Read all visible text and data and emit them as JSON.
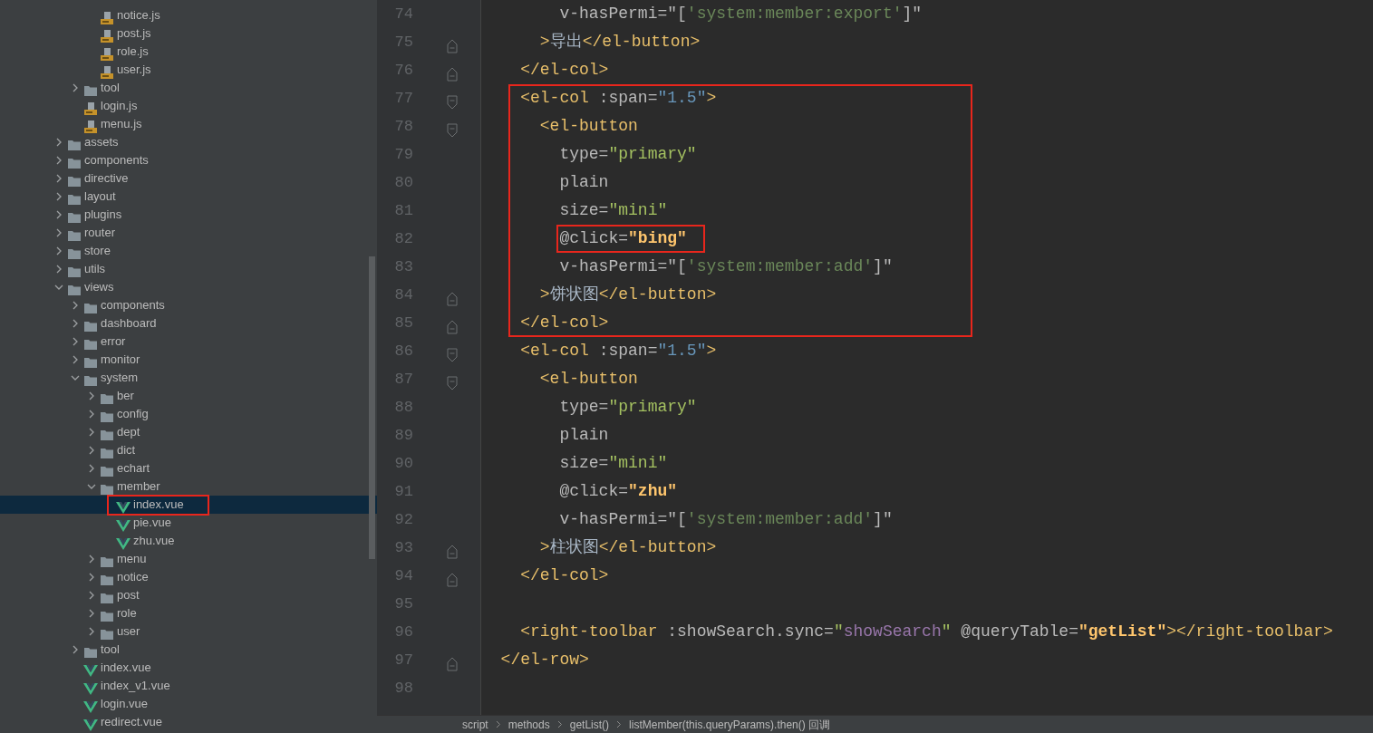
{
  "project_tree": [
    {
      "children": [
        {
          "children": [
            {
              "label": "notice.js",
              "kind": "js",
              "selected": false
            },
            {
              "label": "post.js",
              "kind": "js",
              "selected": false
            },
            {
              "label": "role.js",
              "kind": "js",
              "selected": false
            },
            {
              "label": "user.js",
              "kind": "js",
              "selected": false
            }
          ]
        },
        {
          "label": "tool",
          "kind": "folder",
          "expanded": false,
          "selected": false
        },
        {
          "label": "login.js",
          "kind": "js",
          "selected": false
        },
        {
          "label": "menu.js",
          "kind": "js",
          "selected": false
        }
      ]
    },
    {
      "label": "assets",
      "kind": "folder",
      "expanded": false,
      "selected": false
    },
    {
      "label": "components",
      "kind": "folder",
      "expanded": false,
      "selected": false
    },
    {
      "label": "directive",
      "kind": "folder",
      "expanded": false,
      "selected": false
    },
    {
      "label": "layout",
      "kind": "folder",
      "expanded": false,
      "selected": false
    },
    {
      "label": "plugins",
      "kind": "folder",
      "expanded": false,
      "selected": false
    },
    {
      "label": "router",
      "kind": "folder",
      "expanded": false,
      "selected": false
    },
    {
      "label": "store",
      "kind": "folder",
      "expanded": false,
      "selected": false
    },
    {
      "label": "utils",
      "kind": "folder",
      "expanded": false,
      "selected": false
    },
    {
      "label": "views",
      "kind": "folder",
      "expanded": true,
      "selected": false,
      "children": [
        {
          "label": "components",
          "kind": "folder",
          "expanded": false,
          "selected": false
        },
        {
          "label": "dashboard",
          "kind": "folder",
          "expanded": false,
          "selected": false
        },
        {
          "label": "error",
          "kind": "folder",
          "expanded": false,
          "selected": false
        },
        {
          "label": "monitor",
          "kind": "folder",
          "expanded": false,
          "selected": false
        },
        {
          "label": "system",
          "kind": "folder",
          "expanded": true,
          "selected": false,
          "children": [
            {
              "label": "ber",
              "kind": "folder",
              "expanded": false,
              "selected": false
            },
            {
              "label": "config",
              "kind": "folder",
              "expanded": false,
              "selected": false
            },
            {
              "label": "dept",
              "kind": "folder",
              "expanded": false,
              "selected": false
            },
            {
              "label": "dict",
              "kind": "folder",
              "expanded": false,
              "selected": false
            },
            {
              "label": "echart",
              "kind": "folder",
              "expanded": false,
              "selected": false
            },
            {
              "label": "member",
              "kind": "folder",
              "expanded": true,
              "selected": false,
              "children": [
                {
                  "label": "index.vue",
                  "kind": "vue",
                  "selected": true,
                  "boxed": true
                },
                {
                  "label": "pie.vue",
                  "kind": "vue",
                  "selected": false
                },
                {
                  "label": "zhu.vue",
                  "kind": "vue",
                  "selected": false
                }
              ]
            },
            {
              "label": "menu",
              "kind": "folder",
              "expanded": false,
              "selected": false
            },
            {
              "label": "notice",
              "kind": "folder",
              "expanded": false,
              "selected": false
            },
            {
              "label": "post",
              "kind": "folder",
              "expanded": false,
              "selected": false
            },
            {
              "label": "role",
              "kind": "folder",
              "expanded": false,
              "selected": false
            },
            {
              "label": "user",
              "kind": "folder",
              "expanded": false,
              "selected": false
            }
          ]
        },
        {
          "label": "tool",
          "kind": "folder",
          "expanded": false,
          "selected": false
        },
        {
          "label": "index.vue",
          "kind": "vue",
          "selected": false
        },
        {
          "label": "index_v1.vue",
          "kind": "vue",
          "selected": false
        },
        {
          "label": "login.vue",
          "kind": "vue",
          "selected": false
        },
        {
          "label": "redirect.vue",
          "kind": "vue",
          "selected": false
        }
      ]
    }
  ],
  "editor": {
    "lines": [
      {
        "number": "74",
        "tokens": [
          {
            "text": "        v-hasPermi=\"[",
            "kind": "a"
          },
          {
            "text": "'system:member:export'",
            "kind": "g"
          },
          {
            "text": "]\"",
            "kind": "a"
          }
        ]
      },
      {
        "number": "75",
        "fold_end": true,
        "tokens": [
          {
            "text": "      >",
            "kind": "t"
          },
          {
            "text": "导出",
            "kind": "p"
          },
          {
            "text": "</el-button>",
            "kind": "t"
          }
        ]
      },
      {
        "number": "76",
        "fold_end": true,
        "tokens": [
          {
            "text": "    </el-col>",
            "kind": "t"
          }
        ]
      },
      {
        "number": "77",
        "fold_start": true,
        "boxed": true,
        "tokens": [
          {
            "text": "    <el-col",
            "kind": "t"
          },
          {
            "text": " :span=",
            "kind": "a"
          },
          {
            "text": "\"1.5\"",
            "kind": "n"
          },
          {
            "text": ">",
            "kind": "t"
          }
        ]
      },
      {
        "number": "78",
        "fold_start": true,
        "boxed": true,
        "tokens": [
          {
            "text": "      <el-button",
            "kind": "t"
          }
        ]
      },
      {
        "number": "79",
        "boxed": true,
        "tokens": [
          {
            "text": "        type=",
            "kind": "a"
          },
          {
            "text": "\"primary\"",
            "kind": "s"
          }
        ]
      },
      {
        "number": "80",
        "boxed": true,
        "tokens": [
          {
            "text": "        plain",
            "kind": "a"
          }
        ]
      },
      {
        "number": "81",
        "boxed": true,
        "tokens": [
          {
            "text": "        size=",
            "kind": "a"
          },
          {
            "text": "\"mini\"",
            "kind": "s"
          }
        ]
      },
      {
        "number": "82",
        "boxed": true,
        "token_box": true,
        "tokens": [
          {
            "text": "        @click=",
            "kind": "a"
          },
          {
            "text": "\"bing\"",
            "kind": "f"
          }
        ]
      },
      {
        "number": "83",
        "boxed": true,
        "tokens": [
          {
            "text": "        v-hasPermi=\"[",
            "kind": "a"
          },
          {
            "text": "'system:member:add'",
            "kind": "g"
          },
          {
            "text": "]\"",
            "kind": "a"
          }
        ]
      },
      {
        "number": "84",
        "fold_end": true,
        "boxed": true,
        "tokens": [
          {
            "text": "      >",
            "kind": "t"
          },
          {
            "text": "饼状图",
            "kind": "p"
          },
          {
            "text": "</el-button>",
            "kind": "t"
          }
        ]
      },
      {
        "number": "85",
        "fold_end": true,
        "boxed": true,
        "tokens": [
          {
            "text": "    </el-col>",
            "kind": "t"
          }
        ]
      },
      {
        "number": "86",
        "fold_start": true,
        "tokens": [
          {
            "text": "    <el-col",
            "kind": "t"
          },
          {
            "text": " :span=",
            "kind": "a"
          },
          {
            "text": "\"1.5\"",
            "kind": "n"
          },
          {
            "text": ">",
            "kind": "t"
          }
        ]
      },
      {
        "number": "87",
        "fold_start": true,
        "tokens": [
          {
            "text": "      <el-button",
            "kind": "t"
          }
        ]
      },
      {
        "number": "88",
        "tokens": [
          {
            "text": "        type=",
            "kind": "a"
          },
          {
            "text": "\"primary\"",
            "kind": "s"
          }
        ]
      },
      {
        "number": "89",
        "tokens": [
          {
            "text": "        plain",
            "kind": "a"
          }
        ]
      },
      {
        "number": "90",
        "tokens": [
          {
            "text": "        size=",
            "kind": "a"
          },
          {
            "text": "\"mini\"",
            "kind": "s"
          }
        ]
      },
      {
        "number": "91",
        "tokens": [
          {
            "text": "        @click=",
            "kind": "a"
          },
          {
            "text": "\"zhu\"",
            "kind": "f"
          }
        ]
      },
      {
        "number": "92",
        "tokens": [
          {
            "text": "        v-hasPermi=\"[",
            "kind": "a"
          },
          {
            "text": "'system:member:add'",
            "kind": "g"
          },
          {
            "text": "]\"",
            "kind": "a"
          }
        ]
      },
      {
        "number": "93",
        "fold_end": true,
        "tokens": [
          {
            "text": "      >",
            "kind": "t"
          },
          {
            "text": "柱状图",
            "kind": "p"
          },
          {
            "text": "</el-button>",
            "kind": "t"
          }
        ]
      },
      {
        "number": "94",
        "fold_end": true,
        "tokens": [
          {
            "text": "    </el-col>",
            "kind": "t"
          }
        ]
      },
      {
        "number": "95"
      },
      {
        "number": "96",
        "tokens": [
          {
            "text": "    <right-toolbar",
            "kind": "t"
          },
          {
            "text": " :showSearch.sync=",
            "kind": "a"
          },
          {
            "text": "\"",
            "kind": "s"
          },
          {
            "text": "showSearch",
            "kind": "v"
          },
          {
            "text": "\"",
            "kind": "s"
          },
          {
            "text": " @queryTable=",
            "kind": "a"
          },
          {
            "text": "\"getList\"",
            "kind": "f"
          },
          {
            "text": "></right-toolbar>",
            "kind": "t"
          }
        ]
      },
      {
        "number": "97",
        "fold_end": true,
        "tokens": [
          {
            "text": "  </el-row>",
            "kind": "t"
          }
        ]
      },
      {
        "number": "98"
      }
    ]
  },
  "breadcrumb": [
    "script",
    "methods",
    "getList()",
    "listMember(this.queryParams).then() 回调"
  ]
}
